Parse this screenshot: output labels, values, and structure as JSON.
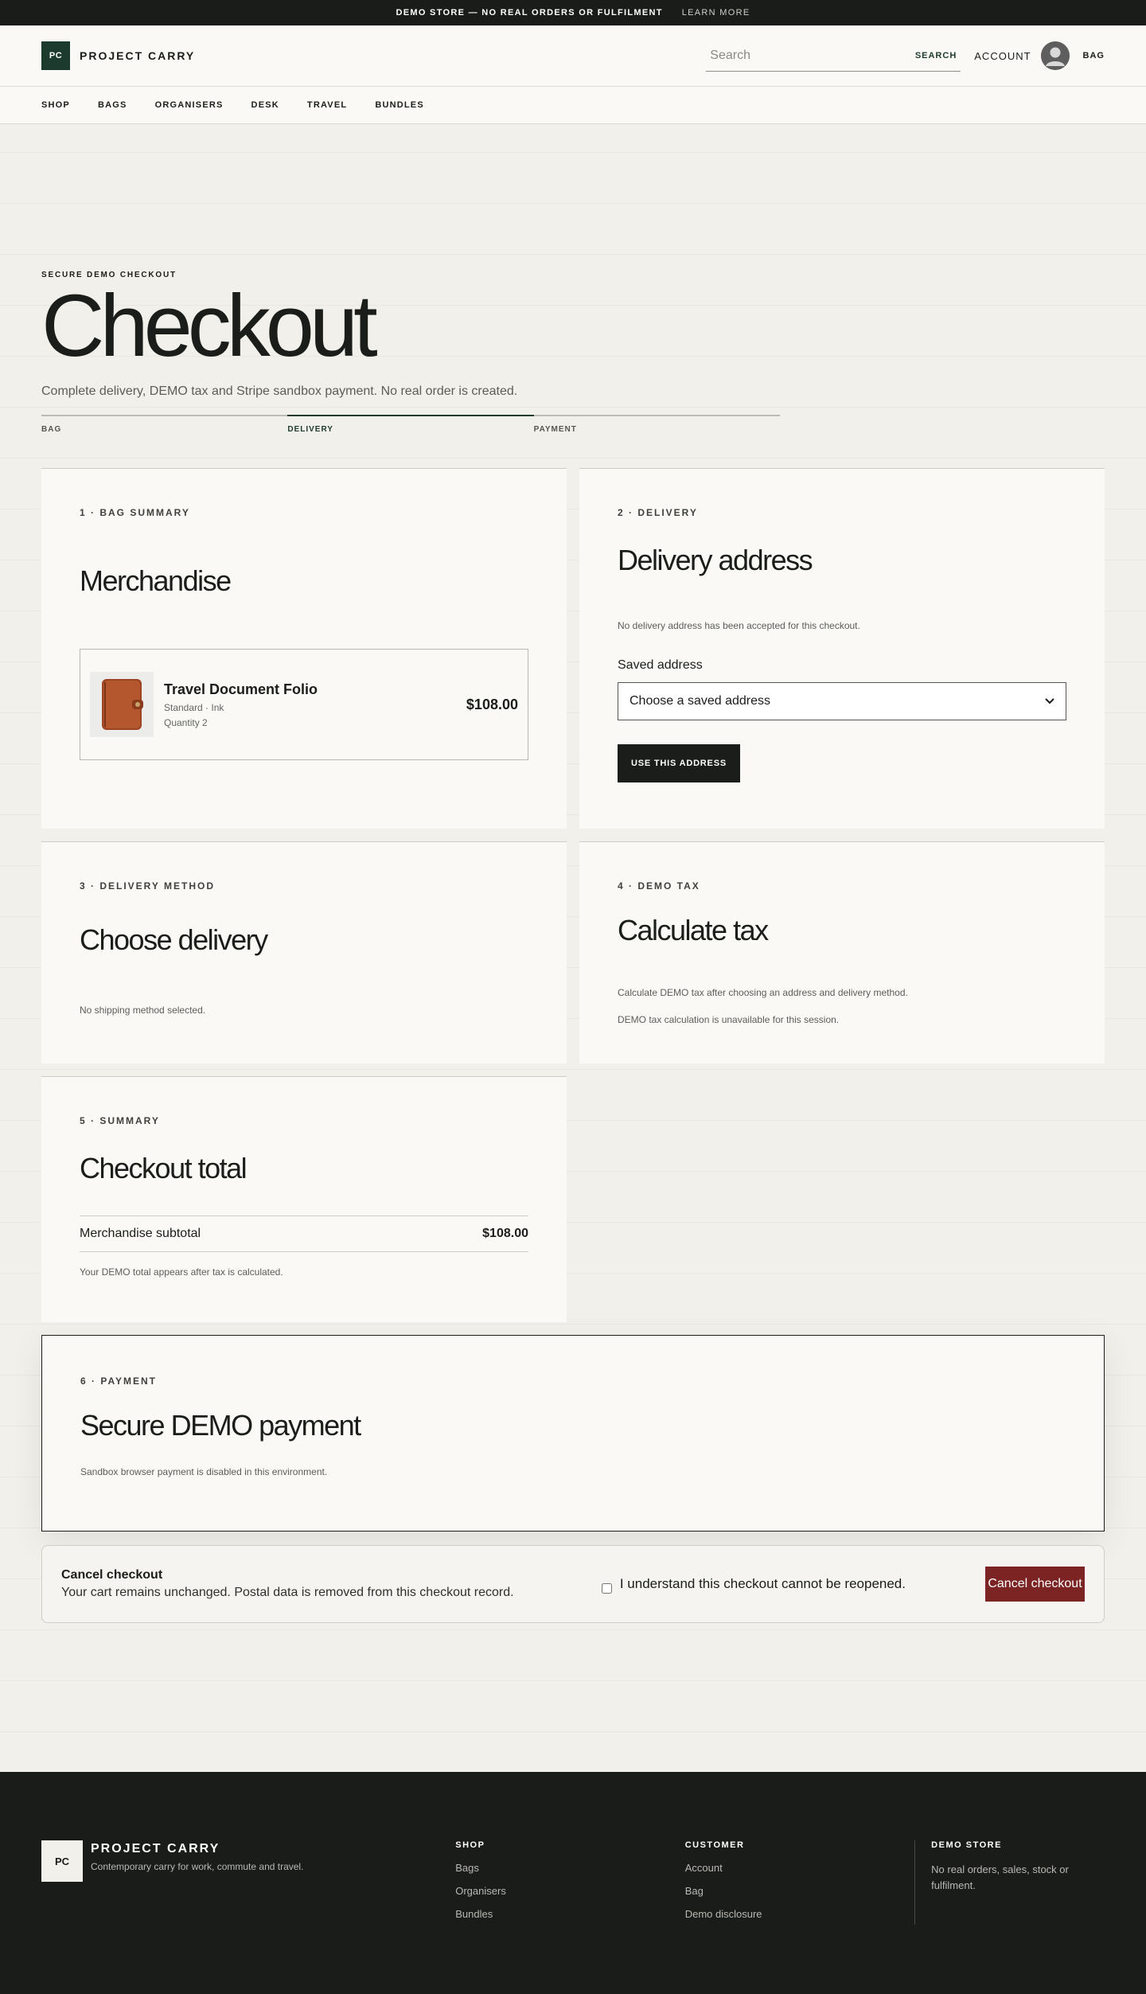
{
  "announcement": {
    "text": "DEMO STORE — NO REAL ORDERS OR FULFILMENT",
    "link": "LEARN MORE"
  },
  "header": {
    "logo_mark": "PC",
    "brand": "PROJECT CARRY",
    "search_placeholder": "Search",
    "search_button": "SEARCH",
    "account": "ACCOUNT",
    "bag": "BAG"
  },
  "nav": [
    "SHOP",
    "BAGS",
    "ORGANISERS",
    "DESK",
    "TRAVEL",
    "BUNDLES"
  ],
  "page": {
    "eyebrow": "SECURE DEMO CHECKOUT",
    "title": "Checkout",
    "subtitle": "Complete delivery, DEMO tax and Stripe sandbox payment. No real order is created."
  },
  "steps": [
    {
      "label": "BAG",
      "active": false
    },
    {
      "label": "DELIVERY",
      "active": true
    },
    {
      "label": "PAYMENT",
      "active": false
    }
  ],
  "bag_summary": {
    "label": "1 · BAG SUMMARY",
    "title": "Merchandise",
    "item": {
      "name": "Travel Document Folio",
      "variant": "Standard · Ink",
      "quantity": "Quantity 2",
      "price": "$108.00"
    }
  },
  "delivery": {
    "label": "2 · DELIVERY",
    "title": "Delivery address",
    "note": "No delivery address has been accepted for this checkout.",
    "saved_label": "Saved address",
    "select_value": "Choose a saved address",
    "button": "USE THIS ADDRESS"
  },
  "delivery_method": {
    "label": "3 · DELIVERY METHOD",
    "title": "Choose delivery",
    "note": "No shipping method selected."
  },
  "tax": {
    "label": "4 · DEMO TAX",
    "title": "Calculate tax",
    "note1": "Calculate DEMO tax after choosing an address and delivery method.",
    "note2": "DEMO tax calculation is unavailable for this session."
  },
  "summary": {
    "label": "5 · SUMMARY",
    "title": "Checkout total",
    "subtotal_label": "Merchandise subtotal",
    "subtotal_value": "$108.00",
    "note": "Your DEMO total appears after tax is calculated."
  },
  "payment": {
    "label": "6 · PAYMENT",
    "title": "Secure DEMO payment",
    "note": "Sandbox browser payment is disabled in this environment."
  },
  "cancel": {
    "title": "Cancel checkout",
    "description": "Your cart remains unchanged. Postal data is removed from this checkout record.",
    "ack": "I understand this checkout cannot be reopened.",
    "button": "Cancel checkout"
  },
  "footer": {
    "logo_mark": "PC",
    "brand": "PROJECT CARRY",
    "tagline": "Contemporary carry for work, commute and travel.",
    "shop": {
      "heading": "SHOP",
      "links": [
        "Bags",
        "Organisers",
        "Bundles"
      ]
    },
    "customer": {
      "heading": "CUSTOMER",
      "links": [
        "Account",
        "Bag",
        "Demo disclosure"
      ]
    },
    "demo": {
      "heading": "DEMO STORE",
      "text": "No real orders, sales, stock or fulfilment."
    }
  },
  "colors": {
    "brand_green": "#1d3a2e",
    "dark": "#1a1c1a",
    "cancel_red": "#7c2424",
    "page_bg": "#f2f0ea",
    "card_bg": "#faf9f6"
  },
  "icons": {
    "avatar": "user-avatar-icon",
    "select": "chevron-down-icon",
    "product": "folio-product-image"
  }
}
